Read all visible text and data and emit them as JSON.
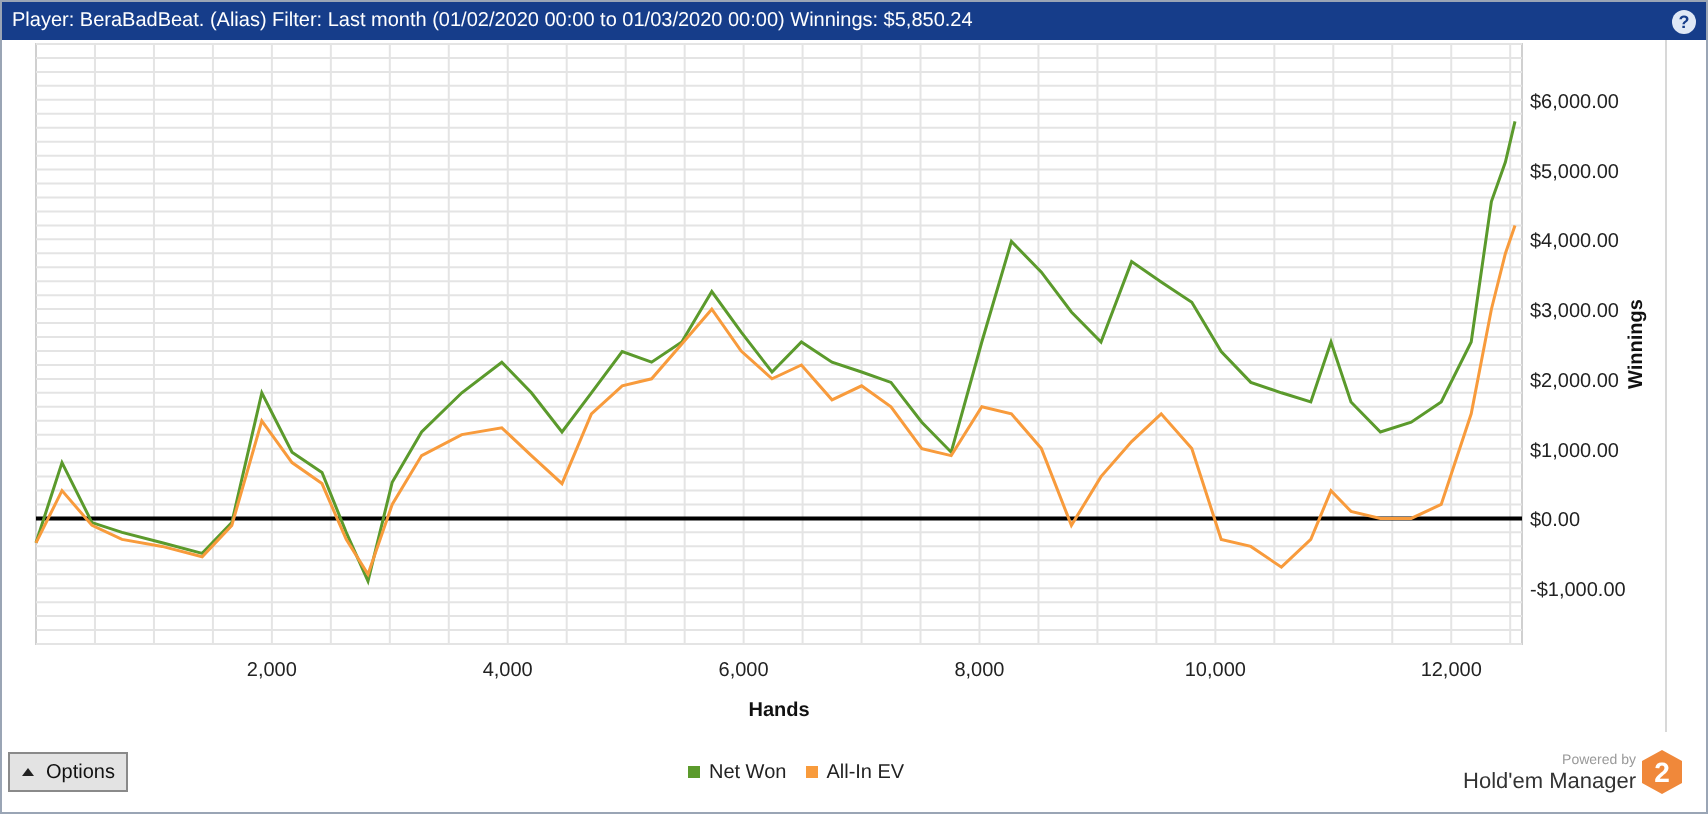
{
  "header": {
    "title": "Player: BeraBadBeat. (Alias) Filter: Last month (01/02/2020 00:00 to 01/03/2020 00:00) Winnings: $5,850.24",
    "help": "?"
  },
  "chart_data": {
    "type": "line",
    "grid": true,
    "xlabel": "Hands",
    "ylabel": "Winnings",
    "xlim": [
      0,
      12600
    ],
    "ylim": [
      -1800,
      6800
    ],
    "xticks": [
      {
        "value": 2000,
        "label": "2,000"
      },
      {
        "value": 4000,
        "label": "4,000"
      },
      {
        "value": 6000,
        "label": "6,000"
      },
      {
        "value": 8000,
        "label": "8,000"
      },
      {
        "value": 10000,
        "label": "10,000"
      },
      {
        "value": 12000,
        "label": "12,000"
      }
    ],
    "yticks": [
      {
        "value": 6000,
        "label": "$6,000.00"
      },
      {
        "value": 5000,
        "label": "$5,000.00"
      },
      {
        "value": 4000,
        "label": "$4,000.00"
      },
      {
        "value": 3000,
        "label": "$3,000.00"
      },
      {
        "value": 2000,
        "label": "$2,000.00"
      },
      {
        "value": 1000,
        "label": "$1,000.00"
      },
      {
        "value": 0,
        "label": "$0.00"
      },
      {
        "value": -1000,
        "label": "-$1,000.00"
      }
    ],
    "x": [
      0,
      220,
      475,
      730,
      1070,
      1410,
      1660,
      1915,
      2170,
      2425,
      2630,
      2815,
      3020,
      3270,
      3610,
      3950,
      4200,
      4460,
      4710,
      4970,
      5220,
      5475,
      5730,
      5980,
      6240,
      6490,
      6750,
      7000,
      7250,
      7510,
      7760,
      8020,
      8270,
      8525,
      8780,
      9030,
      9290,
      9540,
      9800,
      10050,
      10300,
      10560,
      10810,
      10980,
      11150,
      11400,
      11660,
      11915,
      12170,
      12340,
      12460,
      12540
    ],
    "series": [
      {
        "name": "Net Won",
        "color": "#5b9a2c",
        "values": [
          -350,
          800,
          -60,
          -200,
          -350,
          -500,
          -60,
          1800,
          950,
          660,
          -200,
          -900,
          520,
          1240,
          1800,
          2240,
          1800,
          1240,
          1800,
          2390,
          2240,
          2530,
          3250,
          2670,
          2100,
          2530,
          2240,
          2100,
          1950,
          1380,
          950,
          2530,
          3970,
          3530,
          2960,
          2530,
          3680,
          3390,
          3100,
          2390,
          1950,
          1800,
          1670,
          2530,
          1670,
          1240,
          1380,
          1670,
          2530,
          4540,
          5110,
          5690
        ]
      },
      {
        "name": "All-In EV",
        "color": "#f89b3c",
        "values": [
          -350,
          400,
          -100,
          -300,
          -400,
          -550,
          -100,
          1400,
          800,
          500,
          -300,
          -800,
          200,
          900,
          1200,
          1300,
          900,
          500,
          1500,
          1900,
          2000,
          2500,
          3000,
          2400,
          2000,
          2200,
          1700,
          1900,
          1600,
          1000,
          900,
          1600,
          1500,
          1000,
          -100,
          600,
          1100,
          1500,
          1000,
          -300,
          -400,
          -700,
          -300,
          400,
          100,
          0,
          0,
          200,
          1500,
          3000,
          3800,
          4200
        ]
      }
    ]
  },
  "options_button": "Options",
  "logo": {
    "powered_by": "Powered by",
    "name": "Hold'em Manager",
    "badge": "2"
  }
}
